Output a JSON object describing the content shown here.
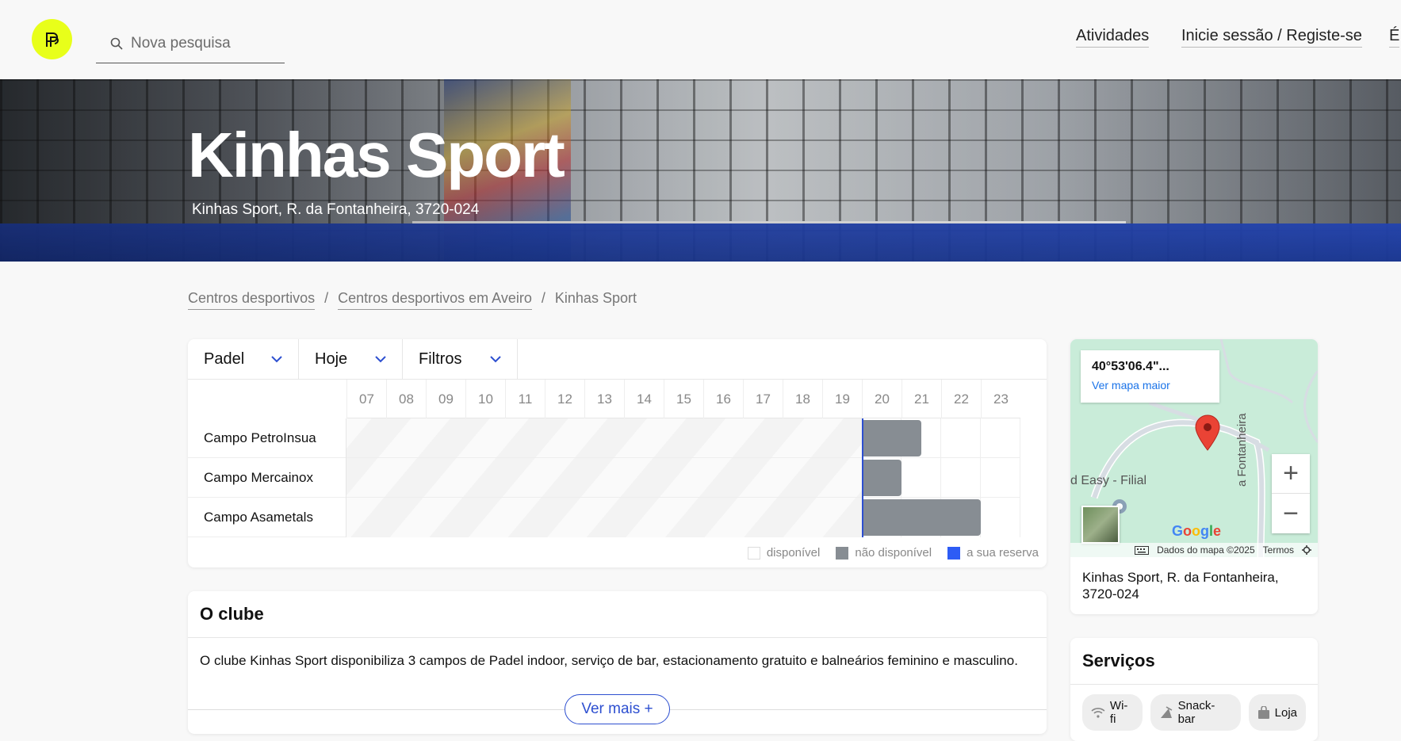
{
  "header": {
    "search_placeholder": "Nova pesquisa",
    "nav_activities": "Atividades",
    "nav_login": "Inicie sessão / Registe-se",
    "nav_more": "É"
  },
  "hero": {
    "title": "Kinhas Sport",
    "address": "Kinhas Sport, R. da Fontanheira, 3720-024"
  },
  "breadcrumb": {
    "item1": "Centros desportivos",
    "item2": "Centros desportivos em Aveiro",
    "item3": "Kinhas Sport",
    "separator": "/"
  },
  "schedule": {
    "filters": {
      "sport": "Padel",
      "day": "Hoje",
      "more": "Filtros"
    },
    "hours": [
      "07",
      "08",
      "09",
      "10",
      "11",
      "12",
      "13",
      "14",
      "15",
      "16",
      "17",
      "18",
      "19",
      "20",
      "21",
      "22",
      "23"
    ],
    "courts": [
      {
        "name": "Campo PetroInsua",
        "busy_start_hour": 20.0,
        "busy_end_hour": 21.5
      },
      {
        "name": "Campo Mercainox",
        "busy_start_hour": 20.0,
        "busy_end_hour": 21.0
      },
      {
        "name": "Campo Asametals",
        "busy_start_hour": 20.0,
        "busy_end_hour": 23.0
      }
    ],
    "now_hour": 20.0,
    "legend": {
      "available": "disponível",
      "unavailable": "não disponível",
      "yours": "a sua reserva"
    },
    "colors": {
      "unavailable": "#878d93",
      "yours": "#2d5cf5",
      "accent": "#2d4fd0"
    }
  },
  "club": {
    "title": "O clube",
    "description": "O clube Kinhas Sport disponibiliza 3 campos de Padel indoor, serviço de bar, estacionamento gratuito e balneários feminino e masculino.",
    "more_button": "Ver mais +"
  },
  "map": {
    "coordinates": "40°53'06.4\"...",
    "view_larger": "Ver mapa maior",
    "place_label": "d Easy - Filial",
    "street_label": "a Fontanheira",
    "google": "Google",
    "map_data": "Dados do mapa ©2025",
    "terms": "Termos",
    "address": "Kinhas Sport, R. da Fontanheira, 3720-024"
  },
  "services": {
    "title": "Serviços",
    "items": [
      {
        "label": "Wi-fi",
        "icon": "wifi-icon"
      },
      {
        "label": "Snack-bar",
        "icon": "snack-bar-icon"
      },
      {
        "label": "Loja",
        "icon": "shop-bag-icon"
      }
    ]
  },
  "brand": {
    "logo_color": "#e8ff1a"
  }
}
